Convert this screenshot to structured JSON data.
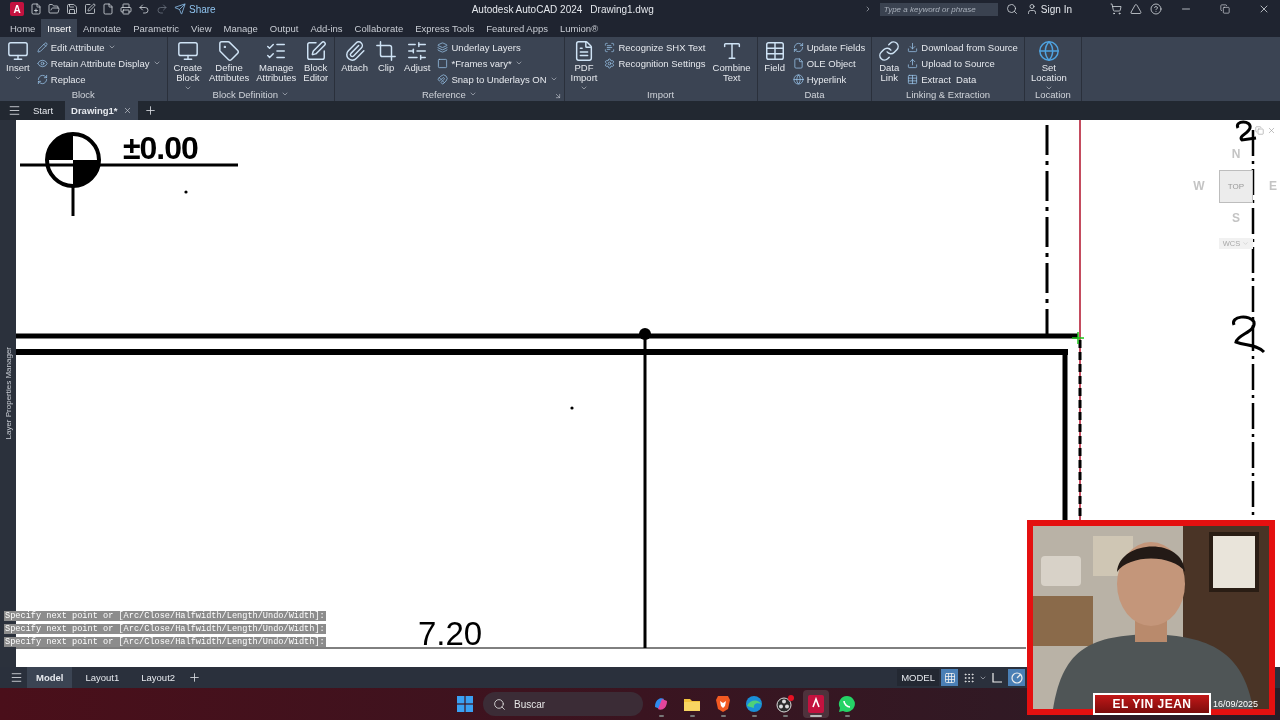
{
  "title_bar": {
    "app_logo": "A",
    "share": "Share",
    "app_title": "Autodesk AutoCAD 2024",
    "document": "Drawing1.dwg",
    "search": {
      "placeholder": "Type a keyword or phrase"
    },
    "sign_in": "Sign In"
  },
  "menu_tabs": [
    {
      "label": "Home",
      "selected": false
    },
    {
      "label": "Insert",
      "selected": true
    },
    {
      "label": "Annotate",
      "selected": false
    },
    {
      "label": "Parametric",
      "selected": false
    },
    {
      "label": "View",
      "selected": false
    },
    {
      "label": "Manage",
      "selected": false
    },
    {
      "label": "Output",
      "selected": false
    },
    {
      "label": "Add-ins",
      "selected": false
    },
    {
      "label": "Collaborate",
      "selected": false
    },
    {
      "label": "Express Tools",
      "selected": false
    },
    {
      "label": "Featured Apps",
      "selected": false
    },
    {
      "label": "Lumion®",
      "selected": false
    }
  ],
  "ribbon": {
    "panels": [
      {
        "title": "Block",
        "menu": false,
        "launcher": false,
        "columns": [
          {
            "kind": "large",
            "label": "Insert",
            "dropdown": true
          },
          {
            "kind": "stack",
            "items": [
              {
                "label": "Edit Attribute",
                "dropdown": true
              },
              {
                "label": "Retain Attribute Display",
                "dropdown": true
              },
              {
                "label": "Replace",
                "dropdown": false
              }
            ]
          }
        ]
      },
      {
        "title": "Block Definition",
        "menu": true,
        "launcher": false,
        "columns": [
          {
            "kind": "large",
            "label": "Create\nBlock",
            "dropdown": true
          },
          {
            "kind": "large",
            "label": "Define\nAttributes",
            "dropdown": false
          },
          {
            "kind": "large",
            "label": "Manage\nAttributes",
            "dropdown": false
          },
          {
            "kind": "large",
            "label": "Block\nEditor",
            "dropdown": false
          }
        ]
      },
      {
        "title": "Reference",
        "menu": true,
        "launcher": true,
        "columns": [
          {
            "kind": "large",
            "label": "Attach",
            "dropdown": false
          },
          {
            "kind": "large",
            "label": "Clip",
            "dropdown": false
          },
          {
            "kind": "large",
            "label": "Adjust",
            "dropdown": false
          },
          {
            "kind": "stack",
            "items": [
              {
                "label": "Underlay Layers",
                "dropdown": false
              },
              {
                "label": "*Frames vary*",
                "dropdown": true
              },
              {
                "label": "Snap to Underlays ON",
                "dropdown": true
              }
            ]
          }
        ]
      },
      {
        "title": "Import",
        "menu": false,
        "launcher": false,
        "columns": [
          {
            "kind": "large",
            "label": "PDF\nImport",
            "dropdown": true
          },
          {
            "kind": "stack",
            "items": [
              {
                "label": "Recognize SHX Text",
                "dropdown": false
              },
              {
                "label": "Recognition Settings",
                "dropdown": false
              }
            ]
          },
          {
            "kind": "large",
            "label": "Combine\nText",
            "dropdown": false
          }
        ]
      },
      {
        "title": "Data",
        "menu": false,
        "launcher": false,
        "columns": [
          {
            "kind": "large",
            "label": "Field",
            "dropdown": false
          },
          {
            "kind": "stack",
            "items": [
              {
                "label": "Update Fields",
                "dropdown": false
              },
              {
                "label": "OLE Object",
                "dropdown": false
              },
              {
                "label": "Hyperlink",
                "dropdown": false
              }
            ]
          }
        ]
      },
      {
        "title": "Linking & Extraction",
        "menu": false,
        "launcher": false,
        "columns": [
          {
            "kind": "large",
            "label": "Data\nLink",
            "dropdown": false
          },
          {
            "kind": "stack",
            "items": [
              {
                "label": "Download from Source",
                "dropdown": false
              },
              {
                "label": "Upload to Source",
                "dropdown": false
              },
              {
                "label": "Extract  Data",
                "dropdown": false
              }
            ]
          }
        ]
      },
      {
        "title": "Location",
        "menu": false,
        "launcher": false,
        "columns": [
          {
            "kind": "large",
            "label": "Set\nLocation",
            "dropdown": true
          }
        ]
      }
    ]
  },
  "file_tabs": [
    {
      "label": "Start",
      "selected": false,
      "closable": false
    },
    {
      "label": "Drawing1*",
      "selected": true,
      "closable": true
    }
  ],
  "side_panel": "Layer Properties Manager",
  "canvas": {
    "level_mark": "±0.00",
    "dimension": "7.20",
    "viewcube": {
      "north": "N",
      "west": "W",
      "face": "TOP",
      "east": "E",
      "south": "S",
      "ucs": "WCS"
    }
  },
  "command_history": [
    "Specify next point or [Arc/Close/Halfwidth/Length/Undo/Width]:",
    "Specify next point or [Arc/Close/Halfwidth/Length/Undo/Width]:",
    "Specify next point or [Arc/Close/Halfwidth/Length/Undo/Width]:"
  ],
  "layout_tabs": [
    {
      "label": "Model",
      "selected": true
    },
    {
      "label": "Layout1",
      "selected": false
    },
    {
      "label": "Layout2",
      "selected": false
    }
  ],
  "status_bar": {
    "space": "MODEL",
    "toggles": [
      {
        "kind": "grid",
        "on": true
      },
      {
        "kind": "snap",
        "on": false
      },
      {
        "kind": "ortho",
        "on": false
      },
      {
        "kind": "polar",
        "on": true
      }
    ]
  },
  "taskbar": {
    "search": {
      "placeholder": "Buscar"
    },
    "apps": [
      {
        "kind": "copilot",
        "active": false
      },
      {
        "kind": "files",
        "active": false
      },
      {
        "kind": "browser_shield",
        "active": false
      },
      {
        "kind": "browser_wave",
        "active": false
      },
      {
        "kind": "recorder",
        "active": false
      },
      {
        "kind": "cad",
        "active": true
      },
      {
        "kind": "chat",
        "active": false
      }
    ],
    "date": "16/09/2025"
  },
  "webcam": {
    "kind": "picture",
    "caption": "EL YIN JEAN"
  }
}
